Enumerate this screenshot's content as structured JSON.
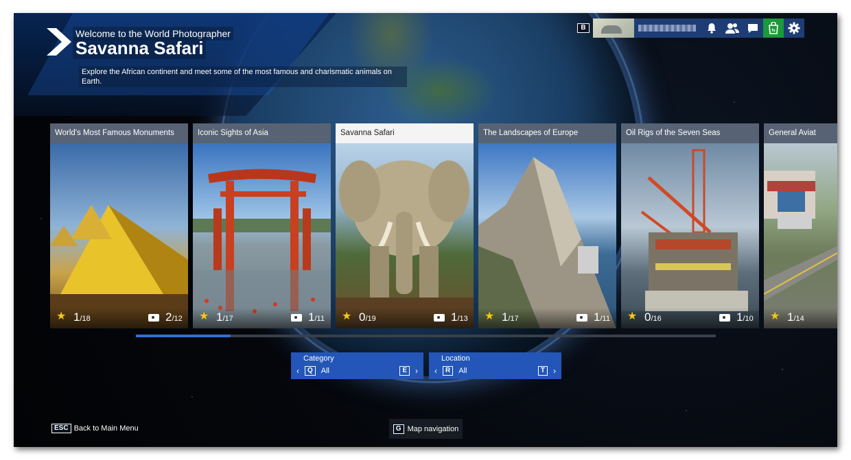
{
  "header": {
    "supertitle": "Welcome to the World Photographer",
    "title": "Savanna Safari",
    "description": "Explore the African continent and meet some of the most famous and charismatic animals on Earth."
  },
  "topbar": {
    "b_key": "B",
    "icons": [
      "bell-icon",
      "friends-icon",
      "chat-icon",
      "shop-icon",
      "gear-icon"
    ]
  },
  "cards": [
    {
      "title": "World's Most Famous Monuments",
      "stars": "1",
      "stars_total": "/18",
      "photos": "2",
      "photos_total": "/12"
    },
    {
      "title": "Iconic Sights of Asia",
      "stars": "1",
      "stars_total": "/17",
      "photos": "1",
      "photos_total": "/11"
    },
    {
      "title": "Savanna Safari",
      "stars": "0",
      "stars_total": "/19",
      "photos": "1",
      "photos_total": "/13"
    },
    {
      "title": "The Landscapes of Europe",
      "stars": "1",
      "stars_total": "/17",
      "photos": "1",
      "photos_total": "/11"
    },
    {
      "title": "Oil Rigs of the Seven Seas",
      "stars": "0",
      "stars_total": "/16",
      "photos": "1",
      "photos_total": "/10"
    },
    {
      "title": "General Aviat",
      "stars": "1",
      "stars_total": "/14"
    }
  ],
  "carousel": {
    "selected_index": 2,
    "scroll_position_fraction": 0.16
  },
  "filters": {
    "category": {
      "label": "Category",
      "prev_key": "Q",
      "value": "All",
      "next_key": "E"
    },
    "location": {
      "label": "Location",
      "prev_key": "R",
      "value": "All",
      "next_key": "T"
    }
  },
  "footer": {
    "esc_key": "ESC",
    "back_label": "Back to Main Menu",
    "map_key": "G",
    "map_label": "Map navigation"
  },
  "colors": {
    "accent": "#2356b8",
    "star": "#f5c518",
    "shop": "#1a9a3a"
  }
}
